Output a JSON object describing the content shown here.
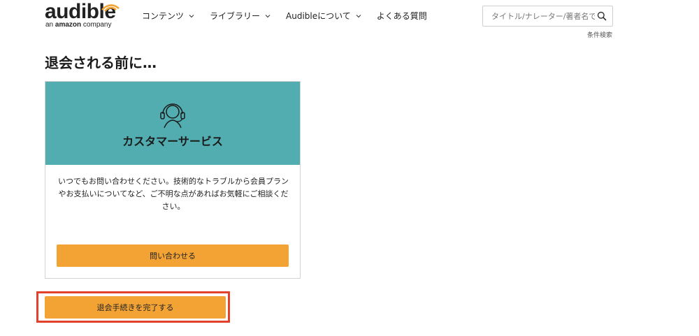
{
  "header": {
    "logo_text": "audible",
    "logo_sub_prefix": "an",
    "logo_sub_brand": "amazon",
    "logo_sub_suffix": "company",
    "nav": [
      {
        "label": "コンテンツ",
        "has_dropdown": true
      },
      {
        "label": "ライブラリー",
        "has_dropdown": true
      },
      {
        "label": "Audibleについて",
        "has_dropdown": true
      },
      {
        "label": "よくある質問",
        "has_dropdown": false
      }
    ],
    "search": {
      "placeholder": "タイトル/ナレーター/著者名で",
      "icon": "search-icon"
    },
    "advanced_search": "条件検索"
  },
  "main": {
    "title": "退会される前に…",
    "card": {
      "icon": "headset-icon",
      "title": "カスタマーサービス",
      "body": "いつでもお問い合わせください。技術的なトラブルから会員プランやお支払いについてなど、ご不明な点があればお気軽にご相談ください。",
      "button": "問い合わせる",
      "header_color": "#52adb0"
    },
    "finish_button": "退会手続きを完了する"
  },
  "colors": {
    "accent_button": "#f3a334",
    "highlight_border": "#e2412b"
  }
}
